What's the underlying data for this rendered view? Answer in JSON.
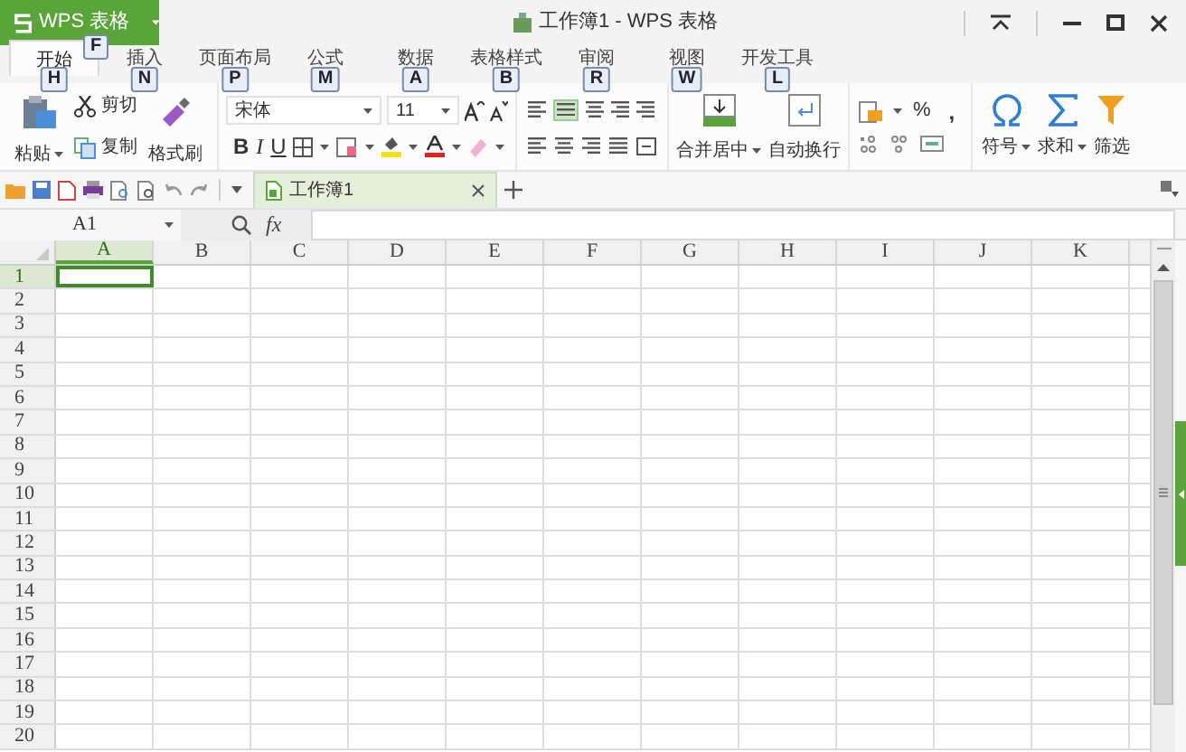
{
  "app_menu": {
    "label": "WPS 表格",
    "key_tip": "F"
  },
  "window_title": "工作簿1 - WPS 表格",
  "ribbon_tabs": [
    {
      "label": "开始",
      "key_tip": "H",
      "selected": true
    },
    {
      "label": "插入",
      "key_tip": "N",
      "selected": false
    },
    {
      "label": "页面布局",
      "key_tip": "P",
      "selected": false
    },
    {
      "label": "公式",
      "key_tip": "M",
      "selected": false
    },
    {
      "label": "数据",
      "key_tip": "A",
      "selected": false
    },
    {
      "label": "表格样式",
      "key_tip": "B",
      "selected": false
    },
    {
      "label": "审阅",
      "key_tip": "R",
      "selected": false
    },
    {
      "label": "视图",
      "key_tip": "W",
      "selected": false
    },
    {
      "label": "开发工具",
      "key_tip": "L",
      "selected": false
    }
  ],
  "ribbon": {
    "paste": "粘贴",
    "cut": "剪切",
    "copy": "复制",
    "format_painter": "格式刷",
    "font_name": "宋体",
    "font_size": "11",
    "bold": "B",
    "italic": "I",
    "underline": "U",
    "merge_center": "合并居中",
    "wrap_text": "自动换行",
    "percent": "%",
    "comma": ",",
    "symbol": "符号",
    "sum": "求和",
    "filter": "筛选"
  },
  "document_tabs": [
    {
      "label": "工作簿1",
      "selected": true
    }
  ],
  "name_box": "A1",
  "formula_label": "fx",
  "columns": [
    {
      "label": "A",
      "selected": true
    },
    {
      "label": "B",
      "selected": false
    },
    {
      "label": "C",
      "selected": false
    },
    {
      "label": "D",
      "selected": false
    },
    {
      "label": "E",
      "selected": false
    },
    {
      "label": "F",
      "selected": false
    },
    {
      "label": "G",
      "selected": false
    },
    {
      "label": "H",
      "selected": false
    },
    {
      "label": "I",
      "selected": false
    },
    {
      "label": "J",
      "selected": false
    },
    {
      "label": "K",
      "selected": false
    }
  ],
  "rows": [
    {
      "label": "1",
      "selected": true
    },
    {
      "label": "2",
      "selected": false
    },
    {
      "label": "3",
      "selected": false
    },
    {
      "label": "4",
      "selected": false
    },
    {
      "label": "5",
      "selected": false
    },
    {
      "label": "6",
      "selected": false
    },
    {
      "label": "7",
      "selected": false
    },
    {
      "label": "8",
      "selected": false
    },
    {
      "label": "9",
      "selected": false
    },
    {
      "label": "10",
      "selected": false
    },
    {
      "label": "11",
      "selected": false
    },
    {
      "label": "12",
      "selected": false
    },
    {
      "label": "13",
      "selected": false
    },
    {
      "label": "14",
      "selected": false
    },
    {
      "label": "15",
      "selected": false
    },
    {
      "label": "16",
      "selected": false
    },
    {
      "label": "17",
      "selected": false
    },
    {
      "label": "18",
      "selected": false
    },
    {
      "label": "19",
      "selected": false
    },
    {
      "label": "20",
      "selected": false
    }
  ]
}
